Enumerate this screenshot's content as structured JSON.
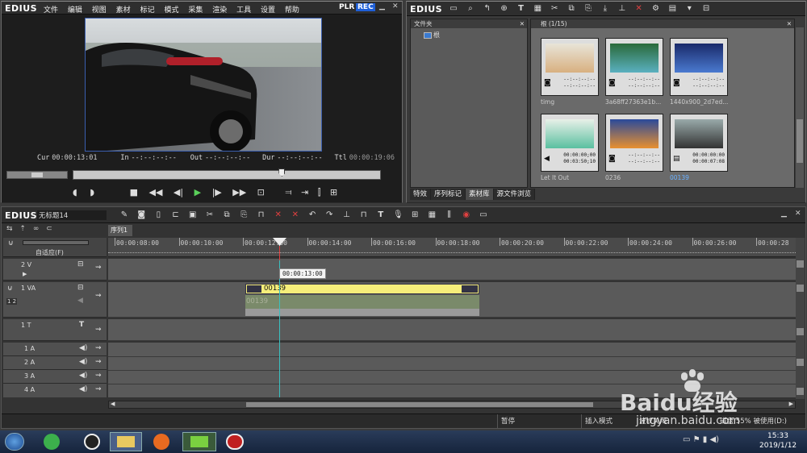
{
  "player": {
    "logo": "EDIUS",
    "menu": [
      "文件",
      "编辑",
      "视图",
      "素材",
      "标记",
      "模式",
      "采集",
      "渲染",
      "工具",
      "设置",
      "帮助"
    ],
    "plr_label": "PLR",
    "rec_label": "REC",
    "timecodes": {
      "cur_label": "Cur",
      "cur_value": "00:00:13:01",
      "in_label": "In",
      "in_value": "--:--:--:--",
      "out_label": "Out",
      "out_value": "--:--:--:--",
      "dur_label": "Dur",
      "dur_value": "--:--:--:--",
      "ttl_label": "Ttl",
      "ttl_value": "00:00:19:06"
    },
    "playhead_fraction": 0.68
  },
  "bin": {
    "logo": "EDIUS",
    "folder_header": "文件夹",
    "folder_root": "根",
    "path_label": "根 (1/15)",
    "clips": [
      {
        "name": "timg",
        "tc1": "--:--:--:--",
        "tc2": "--:--:--:--",
        "kind": "still"
      },
      {
        "name": "3a68ff27363e1b...",
        "tc1": "--:--:--:--",
        "tc2": "--:--:--:--",
        "kind": "still"
      },
      {
        "name": "1440x900_2d7ed...",
        "tc1": "--:--:--:--",
        "tc2": "--:--:--:--",
        "kind": "still"
      },
      {
        "name": "Let It Out",
        "tc1": "00:00:00;00",
        "tc2": "00:03:50;10",
        "kind": "audio"
      },
      {
        "name": "0236",
        "tc1": "--:--:--:--",
        "tc2": "--:--:--:--",
        "kind": "still"
      },
      {
        "name": "00139",
        "tc1": "00:00:00:00",
        "tc2": "00:00:07:08",
        "kind": "video"
      }
    ],
    "tabs": [
      "特效",
      "序列标记",
      "素材库",
      "源文件浏览"
    ]
  },
  "timeline": {
    "logo": "EDIUS",
    "project_name": "无标题14",
    "sequence_tab": "序列1",
    "mode_label": "自适应(F)",
    "ruler": [
      "00:00:08:00",
      "00:00:10:00",
      "00:00:12:00",
      "00:00:14:00",
      "00:00:16:00",
      "00:00:18:00",
      "00:00:20:00",
      "00:00:22:00",
      "00:00:24:00",
      "00:00:26:00",
      "00:00:28"
    ],
    "playhead_tc": "00:00:13:00",
    "tracks": {
      "v2": "2 V",
      "va1": "1 VA",
      "t1": "1 T",
      "a1": "1 A",
      "a2": "2 A",
      "a3": "3 A",
      "a4": "4 A"
    },
    "va_side": "1 2",
    "clip_video_label": "00139",
    "clip_audio_label": "00139"
  },
  "status": {
    "pause": "暂停",
    "insert_mode": "插入模式",
    "ripple": "波纹关闭",
    "disk": "磁盘:55% 被使用(D:)"
  },
  "taskbar": {
    "time": "15:33",
    "date": "2019/1/12"
  },
  "watermark": {
    "brand": "Baidu经验",
    "url": "jingyan.baidu.com"
  },
  "colors": {
    "rec": "#1e5fd8",
    "clip_yellow": "#f6ee7a",
    "playhead": "#e04040",
    "timeline_bg": "#5a5a5a",
    "taskbar": "#1a2a44"
  }
}
